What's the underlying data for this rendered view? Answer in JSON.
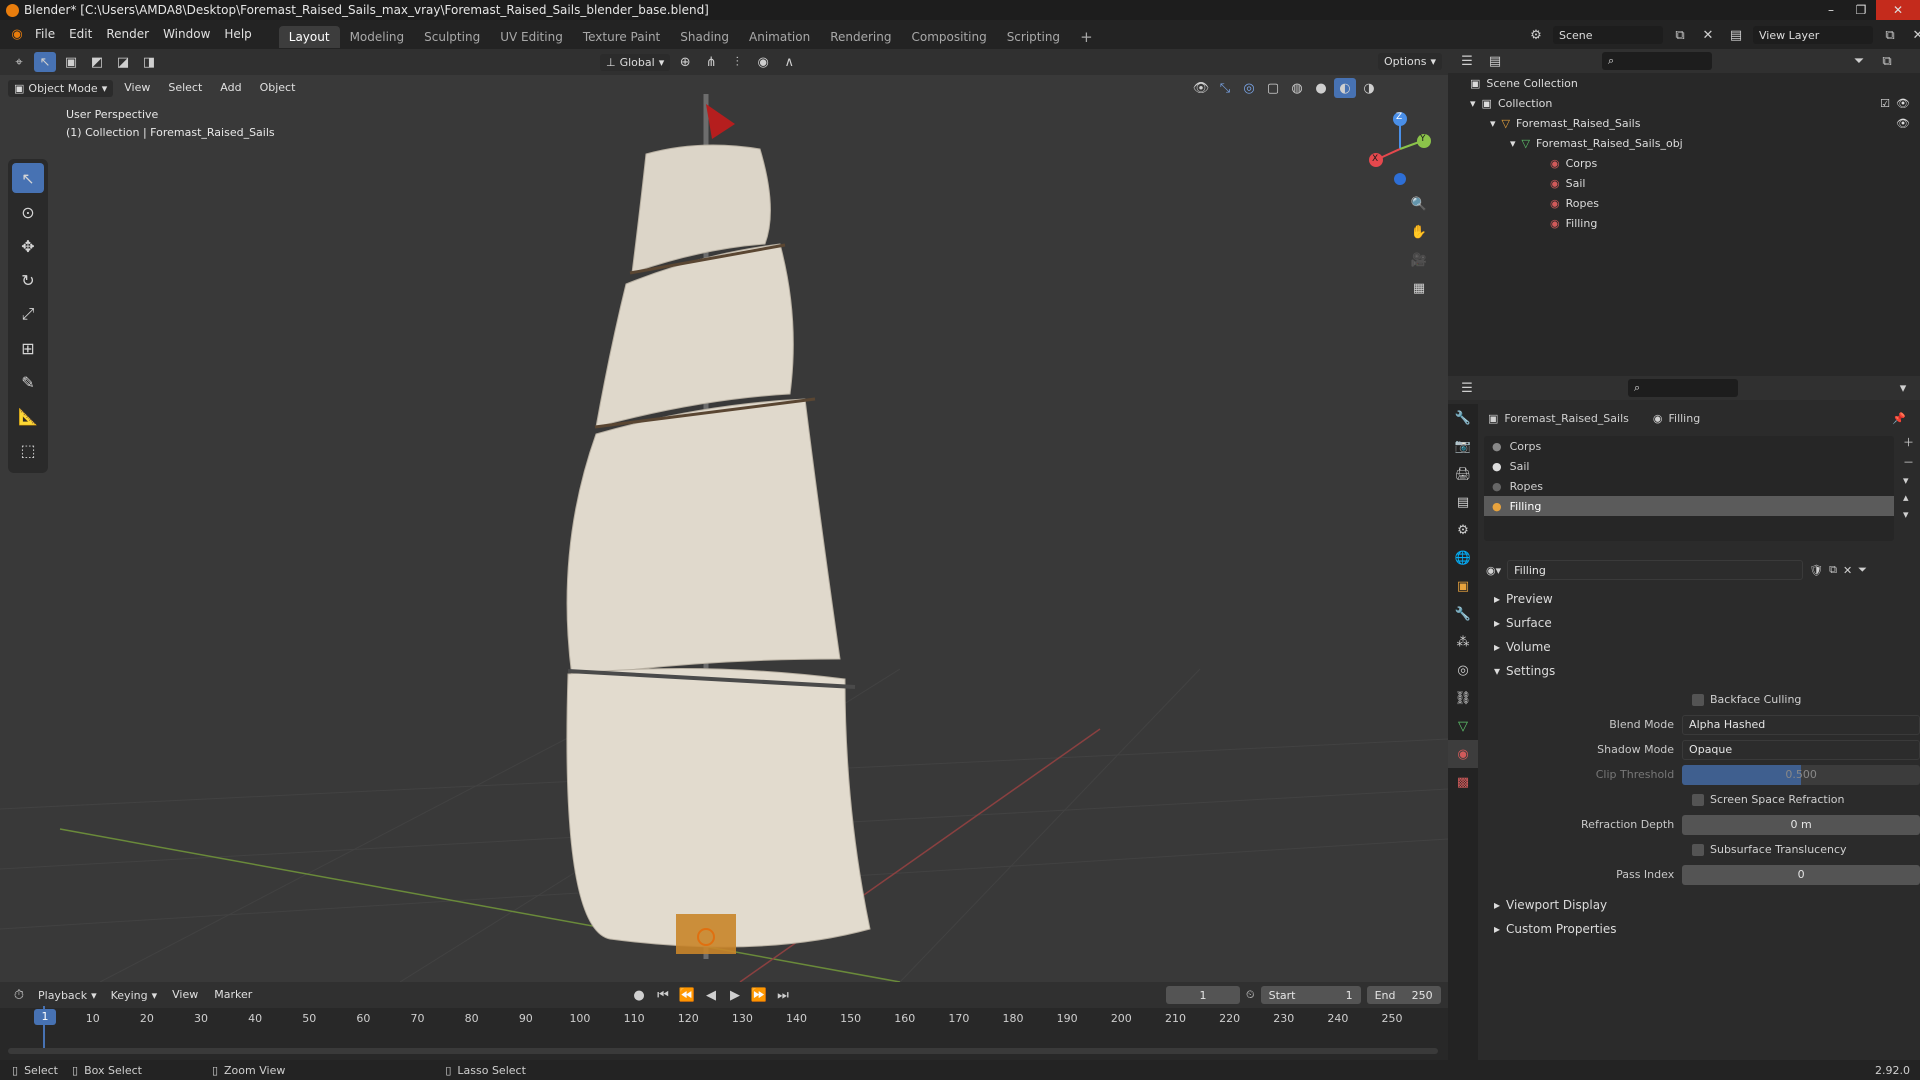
{
  "window": {
    "title": "Blender* [C:\\Users\\AMDA8\\Desktop\\Foremast_Raised_Sails_max_vray\\Foremast_Raised_Sails_blender_base.blend]",
    "controls": [
      "–",
      "❐",
      "✕"
    ]
  },
  "menubar": {
    "items": [
      "File",
      "Edit",
      "Render",
      "Window",
      "Help"
    ],
    "workspaces": [
      "Layout",
      "Modeling",
      "Sculpting",
      "UV Editing",
      "Texture Paint",
      "Shading",
      "Animation",
      "Rendering",
      "Compositing",
      "Scripting"
    ],
    "active_workspace": "Layout",
    "add_tab": "+",
    "scene": "Scene",
    "view_layer": "View Layer"
  },
  "viewport": {
    "header": {
      "orientation": "Global",
      "options": "Options",
      "mode": "Object Mode",
      "menus": [
        "View",
        "Select",
        "Add",
        "Object"
      ]
    },
    "overlay_text": {
      "perspective": "User Perspective",
      "collection": "(1) Collection | Foremast_Raised_Sails"
    },
    "gizmo_axes": {
      "x": "X",
      "y": "Y",
      "z": "Z"
    }
  },
  "outliner": {
    "root": "Scene Collection",
    "collection": "Collection",
    "object": "Foremast_Raised_Sails",
    "mesh": "Foremast_Raised_Sails_obj",
    "materials": [
      "Corps",
      "Sail",
      "Ropes",
      "Filling"
    ]
  },
  "properties": {
    "breadcrumb": {
      "object": "Foremast_Raised_Sails",
      "material": "Filling"
    },
    "material_slots": [
      "Corps",
      "Sail",
      "Ropes",
      "Filling"
    ],
    "active_slot": "Filling",
    "material_name": "Filling",
    "panels": {
      "preview": "Preview",
      "surface": "Surface",
      "volume": "Volume",
      "settings": "Settings",
      "viewport_display": "Viewport Display",
      "custom_properties": "Custom Properties"
    },
    "settings": {
      "backface_culling": "Backface Culling",
      "blend_mode_label": "Blend Mode",
      "blend_mode": "Alpha Hashed",
      "shadow_mode_label": "Shadow Mode",
      "shadow_mode": "Opaque",
      "clip_threshold_label": "Clip Threshold",
      "clip_threshold": "0.500",
      "screen_space_refraction": "Screen Space Refraction",
      "refraction_depth_label": "Refraction Depth",
      "refraction_depth": "0 m",
      "subsurface_translucency": "Subsurface Translucency",
      "pass_index_label": "Pass Index",
      "pass_index": "0"
    }
  },
  "timeline": {
    "menus": [
      "Playback",
      "Keying",
      "View",
      "Marker"
    ],
    "current_frame": "1",
    "start_label": "Start",
    "start": "1",
    "end_label": "End",
    "end": "250",
    "ticks": [
      "10",
      "20",
      "30",
      "40",
      "50",
      "60",
      "70",
      "80",
      "90",
      "100",
      "110",
      "120",
      "130",
      "140",
      "150",
      "160",
      "170",
      "180",
      "190",
      "200",
      "210",
      "220",
      "230",
      "240",
      "250"
    ],
    "playhead_label": "1"
  },
  "statusbar": {
    "select": "Select",
    "box_select": "Box Select",
    "zoom_view": "Zoom View",
    "lasso_select": "Lasso Select",
    "version": "2.92.0"
  },
  "colors": {
    "accent": "#4772b3",
    "x_axis": "#e5484d",
    "y_axis": "#8bc34a",
    "z_axis": "#4a8fe8"
  }
}
